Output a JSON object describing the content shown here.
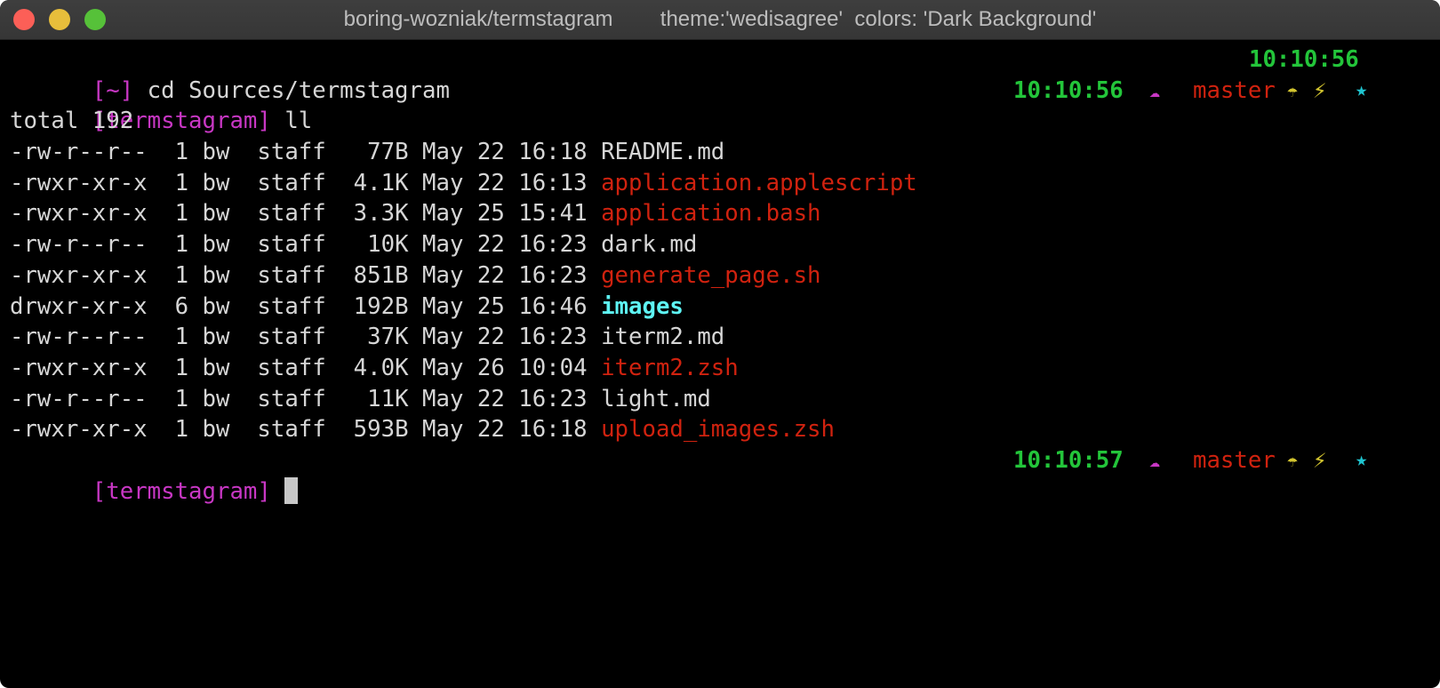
{
  "window": {
    "title": "boring-wozniak/termstagram        theme:'wedisagree'  colors: 'Dark Background'"
  },
  "lines": [
    {
      "prompt": "[~]",
      "command": "cd Sources/termstagram",
      "time": "10:10:56"
    },
    {
      "prompt": "[termstagram]",
      "command": "ll",
      "time": "10:10:56",
      "branch": "master"
    }
  ],
  "total": "total 192",
  "files": [
    {
      "perms": "-rw-r--r--",
      "links": "1",
      "owner": "bw",
      "group": "staff",
      "size": "77B",
      "date": "May 22 16:18",
      "name": "README.md",
      "type": "file"
    },
    {
      "perms": "-rwxr-xr-x",
      "links": "1",
      "owner": "bw",
      "group": "staff",
      "size": "4.1K",
      "date": "May 22 16:13",
      "name": "application.applescript",
      "type": "exec"
    },
    {
      "perms": "-rwxr-xr-x",
      "links": "1",
      "owner": "bw",
      "group": "staff",
      "size": "3.3K",
      "date": "May 25 15:41",
      "name": "application.bash",
      "type": "exec"
    },
    {
      "perms": "-rw-r--r--",
      "links": "1",
      "owner": "bw",
      "group": "staff",
      "size": "10K",
      "date": "May 22 16:23",
      "name": "dark.md",
      "type": "file"
    },
    {
      "perms": "-rwxr-xr-x",
      "links": "1",
      "owner": "bw",
      "group": "staff",
      "size": "851B",
      "date": "May 22 16:23",
      "name": "generate_page.sh",
      "type": "exec"
    },
    {
      "perms": "drwxr-xr-x",
      "links": "6",
      "owner": "bw",
      "group": "staff",
      "size": "192B",
      "date": "May 25 16:46",
      "name": "images",
      "type": "dir"
    },
    {
      "perms": "-rw-r--r--",
      "links": "1",
      "owner": "bw",
      "group": "staff",
      "size": "37K",
      "date": "May 22 16:23",
      "name": "iterm2.md",
      "type": "file"
    },
    {
      "perms": "-rwxr-xr-x",
      "links": "1",
      "owner": "bw",
      "group": "staff",
      "size": "4.0K",
      "date": "May 26 10:04",
      "name": "iterm2.zsh",
      "type": "exec"
    },
    {
      "perms": "-rw-r--r--",
      "links": "1",
      "owner": "bw",
      "group": "staff",
      "size": "11K",
      "date": "May 22 16:23",
      "name": "light.md",
      "type": "file"
    },
    {
      "perms": "-rwxr-xr-x",
      "links": "1",
      "owner": "bw",
      "group": "staff",
      "size": "593B",
      "date": "May 22 16:18",
      "name": "upload_images.zsh",
      "type": "exec"
    }
  ],
  "current": {
    "prompt": "[termstagram]",
    "time": "10:10:57",
    "branch": "master"
  },
  "icons": {
    "cloud": "☁",
    "umbrella": "☂",
    "bolt": "⚡",
    "star": "★"
  },
  "colors": {
    "prompt": "#c837c4",
    "time": "#23c53a",
    "branch": "#d0220f",
    "exec": "#d0220f",
    "dir": "#5ef5f5"
  }
}
